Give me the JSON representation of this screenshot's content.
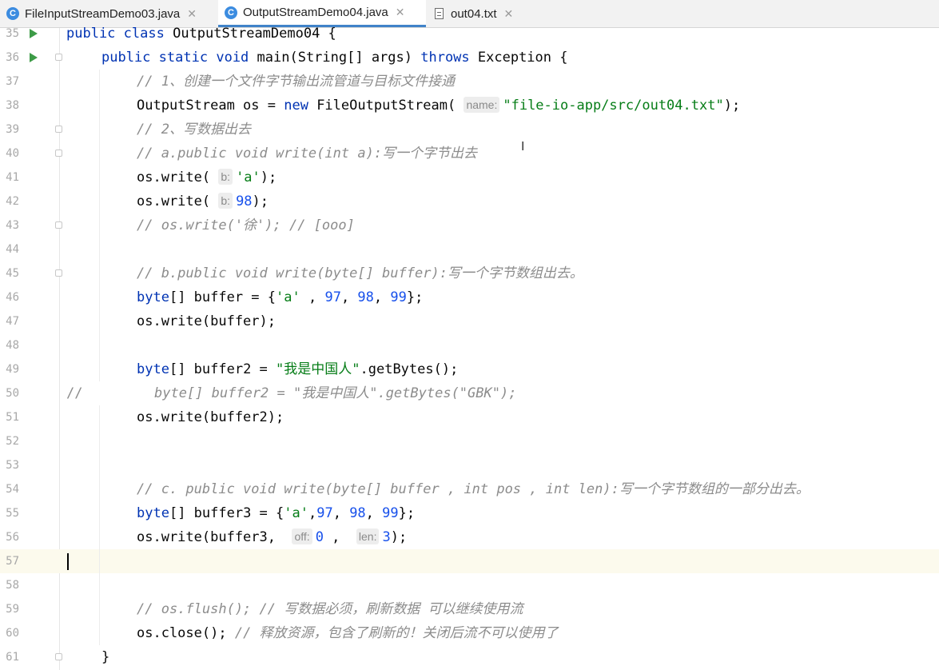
{
  "tabs": [
    {
      "label": "FileInputStreamDemo03.java",
      "icon": "java-class-icon",
      "active": false
    },
    {
      "label": "OutputStreamDemo04.java",
      "icon": "java-class-icon",
      "active": true
    },
    {
      "label": "out04.txt",
      "icon": "text-file-icon",
      "active": false
    }
  ],
  "tab_close_glyph": "✕",
  "class_icon_letter": "C",
  "colors": {
    "keyword": "#0033b3",
    "string": "#067d17",
    "number": "#1750eb",
    "comment": "#8c8c8c",
    "run_icon": "#3d9b47",
    "tab_underline": "#4083c9"
  },
  "editor": {
    "current_line": "57",
    "lines": [
      {
        "n": "35"
      },
      {
        "n": "36"
      },
      {
        "n": "37"
      },
      {
        "n": "38"
      },
      {
        "n": "39"
      },
      {
        "n": "40"
      },
      {
        "n": "41"
      },
      {
        "n": "42"
      },
      {
        "n": "43"
      },
      {
        "n": "44"
      },
      {
        "n": "45"
      },
      {
        "n": "46"
      },
      {
        "n": "47"
      },
      {
        "n": "48"
      },
      {
        "n": "49"
      },
      {
        "n": "50"
      },
      {
        "n": "51"
      },
      {
        "n": "52"
      },
      {
        "n": "53"
      },
      {
        "n": "54"
      },
      {
        "n": "55"
      },
      {
        "n": "56"
      },
      {
        "n": "57"
      },
      {
        "n": "58"
      },
      {
        "n": "59"
      },
      {
        "n": "60"
      },
      {
        "n": "61"
      }
    ],
    "code": {
      "l35": {
        "kw1": "public",
        "kw2": "class",
        "rest": " OutputStreamDemo04 {"
      },
      "l36": {
        "kw1": "public",
        "kw2": "static",
        "kw3": "void",
        "t1": " main(String[] args) ",
        "kw4": "throws",
        "t2": " Exception {"
      },
      "l37": {
        "comment": "// 1、创建一个文件字节输出流管道与目标文件接通"
      },
      "l38": {
        "t1": "OutputStream os = ",
        "kw": "new",
        "t2": " FileOutputStream(",
        "hint": "name:",
        "str": "\"file-io-app/src/out04.txt\"",
        "t3": ");"
      },
      "l39": {
        "comment": "// 2、写数据出去"
      },
      "l40": {
        "comment": "// a.public void write(int a):写一个字节出去"
      },
      "l41": {
        "t1": "os.write(",
        "hint": "b:",
        "str": "'a'",
        "t2": ");"
      },
      "l42": {
        "t1": "os.write(",
        "hint": "b:",
        "num": "98",
        "t2": ");"
      },
      "l43": {
        "comment": "// os.write('徐'); // [ooo]"
      },
      "l45": {
        "comment": "// b.public void write(byte[] buffer):写一个字节数组出去。"
      },
      "l46": {
        "kw": "byte",
        "t1": "[] buffer = {",
        "s1": "'a'",
        "t2": " , ",
        "n1": "97",
        "t3": ", ",
        "n2": "98",
        "t4": ", ",
        "n3": "99",
        "t5": "};"
      },
      "l47": {
        "t1": "os.write(buffer);"
      },
      "l49": {
        "kw": "byte",
        "t1": "[] buffer2 = ",
        "str": "\"我是中国人\"",
        "t2": ".getBytes();"
      },
      "l50": {
        "prefix": "//",
        "comment": "byte[] buffer2 = \"我是中国人\".getBytes(\"GBK\");"
      },
      "l51": {
        "t1": "os.write(buffer2);"
      },
      "l54": {
        "comment": "// c. public void write(byte[] buffer , int pos , int len):写一个字节数组的一部分出去。"
      },
      "l55": {
        "kw": "byte",
        "t1": "[] buffer3 = {",
        "s1": "'a'",
        "t2": ",",
        "n1": "97",
        "t3": ", ",
        "n2": "98",
        "t4": ", ",
        "n3": "99",
        "t5": "};"
      },
      "l56": {
        "t1": "os.write(buffer3, ",
        "hint1": "off:",
        "n1": "0",
        "t2": " , ",
        "hint2": "len:",
        "n2": "3",
        "t3": ");"
      },
      "l59": {
        "comment": "// os.flush(); // 写数据必须，刷新数据 可以继续使用流"
      },
      "l60": {
        "t1": "os.close(); ",
        "comment": "// 释放资源，包含了刷新的！关闭后流不可以使用了"
      },
      "l61": {
        "t1": "}"
      }
    }
  }
}
